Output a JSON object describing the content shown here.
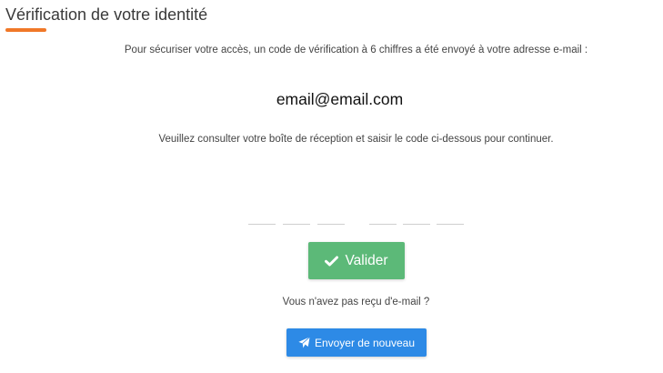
{
  "header": {
    "title": "Vérification de votre identité"
  },
  "main": {
    "intro": "Pour sécuriser votre accès, un code de vérification à 6 chiffres a été envoyé à votre adresse e-mail :",
    "email": "email@email.com",
    "instructions": "Veuillez consulter votre boîte de réception et saisir le code ci-dessous pour continuer.",
    "code_digits": [
      "",
      "",
      "",
      "",
      "",
      ""
    ],
    "validate_label": "Valider",
    "no_email_text": "Vous n'avez pas reçu d'e-mail ?",
    "resend_label": "Envoyer de nouveau"
  },
  "icons": {
    "validate": "check-icon",
    "resend": "paper-plane-icon"
  },
  "colors": {
    "accent_underline": "#f07828",
    "validate_button": "#5cb978",
    "resend_button": "#2d8ae6"
  }
}
